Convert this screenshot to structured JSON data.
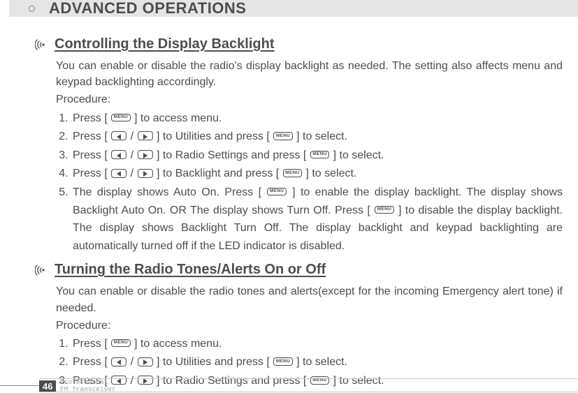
{
  "header": {
    "title": "ADVANCED OPERATIONS"
  },
  "section1": {
    "title": "Controlling the Display Backlight",
    "intro": "You can enable or disable the radio's display backlight as needed.  The setting  also affects menu and keypad backlighting accordingly.",
    "procedure_label": "Procedure:",
    "steps": {
      "s1a": "Press [ ",
      "s1b": " ] to access menu.",
      "s2a": "Press [ ",
      "s2b": " / ",
      "s2c": " ] to Utilities and press [ ",
      "s2d": " ] to select.",
      "s3a": "Press [ ",
      "s3b": " / ",
      "s3c": " ] to Radio Settings and press [ ",
      "s3d": " ] to select.",
      "s4a": "Press [ ",
      "s4b": " / ",
      "s4c": " ] to Backlight and press [ ",
      "s4d": " ] to select.",
      "s5a": "The display shows Auto On. Press [ ",
      "s5b": " ] to enable the display backlight. The display shows Backlight Auto On. OR The display shows Turn Off. Press [ ",
      "s5c": " ] to disable the display backlight. The display shows Backlight Turn Off. The display backlight and  keypad  backlighting  are automatically  turned  off  if  the  LED  indicator  is disabled."
    }
  },
  "section2": {
    "title": "Turning the Radio Tones/Alerts On or Off",
    "intro": "You  can  enable  or  disable  the  radio  tones  and alerts(except for the incoming Emergency alert tone) if needed.",
    "procedure_label": "Procedure:",
    "steps": {
      "s1a": "Press [ ",
      "s1b": " ] to access menu.",
      "s2a": "Press [ ",
      "s2b": " / ",
      "s2c": " ] to Utilities and press [ ",
      "s2d": " ] to select.",
      "s3a": "Press [ ",
      "s3b": " / ",
      "s3c": " ] to Radio Settings and press [ ",
      "s3d": " ] to select."
    }
  },
  "icons": {
    "menu_label": "MENU"
  },
  "footer": {
    "page": "46",
    "brand1": "Professional",
    "brand2": "FM Transceiver"
  }
}
